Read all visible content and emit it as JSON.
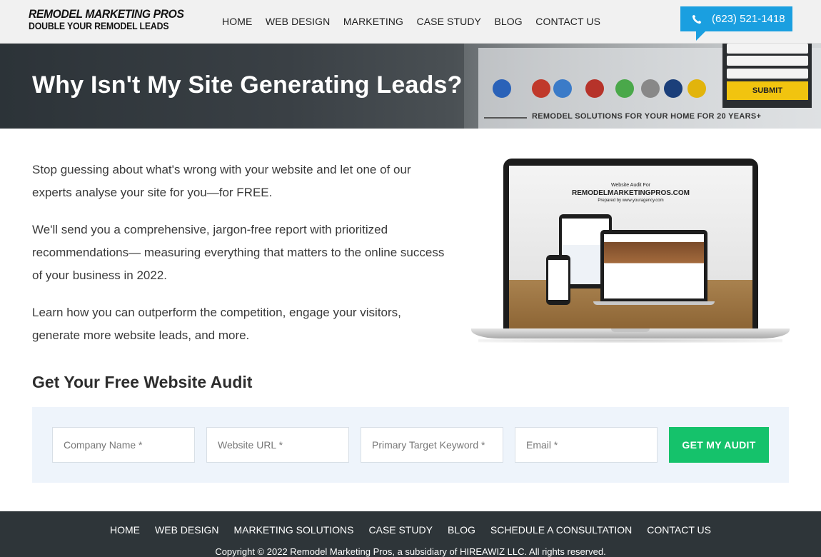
{
  "header": {
    "logo_line1": "REMODEL MARKETING PROS",
    "logo_line2": "DOUBLE YOUR REMODEL LEADS",
    "nav": [
      "HOME",
      "WEB DESIGN",
      "MARKETING",
      "CASE STUDY",
      "BLOG",
      "CONTACT US"
    ],
    "phone": "(623) 521-1418",
    "phone_icon": "phone-icon"
  },
  "hero": {
    "title": "Why Isn't My Site Generating Leads?",
    "tagline": "REMODEL SOLUTIONS FOR YOUR HOME FOR 20 YEARS+",
    "submit_label": "SUBMIT"
  },
  "intro": {
    "paragraphs": [
      "Stop guessing about what's wrong with your website and let one of our experts analyse your site for you—for FREE.",
      "We'll send you a comprehensive, jargon-free report with prioritized recommendations— measuring everything that matters to the online success of your business in 2022.",
      "Learn how you can outperform the competition, engage your visitors, generate more website leads, and more."
    ]
  },
  "laptop": {
    "line1": "Website Audit For",
    "line2": "REMODELMARKETINGPROS.COM",
    "line3": "Prepared by www.youragency.com"
  },
  "audit": {
    "heading": "Get Your Free Website Audit",
    "fields": [
      {
        "placeholder": "Company Name *"
      },
      {
        "placeholder": "Website URL *"
      },
      {
        "placeholder": "Primary Target Keyword *"
      },
      {
        "placeholder": "Email *"
      }
    ],
    "submit_label": "GET MY AUDIT"
  },
  "footer": {
    "nav": [
      "HOME",
      "WEB DESIGN",
      "MARKETING SOLUTIONS",
      "CASE STUDY",
      "BLOG",
      "SCHEDULE A CONSULTATION",
      "CONTACT US"
    ],
    "copyright": "Copyright © 2022 Remodel Marketing Pros, a subsidiary of HIREAWIZ LLC. All rights reserved."
  },
  "colors": {
    "phone_bg": "#1a9fe0",
    "cta_green": "#15c26b",
    "footer_bg": "#2e3539",
    "form_bg": "#eef4fb"
  }
}
